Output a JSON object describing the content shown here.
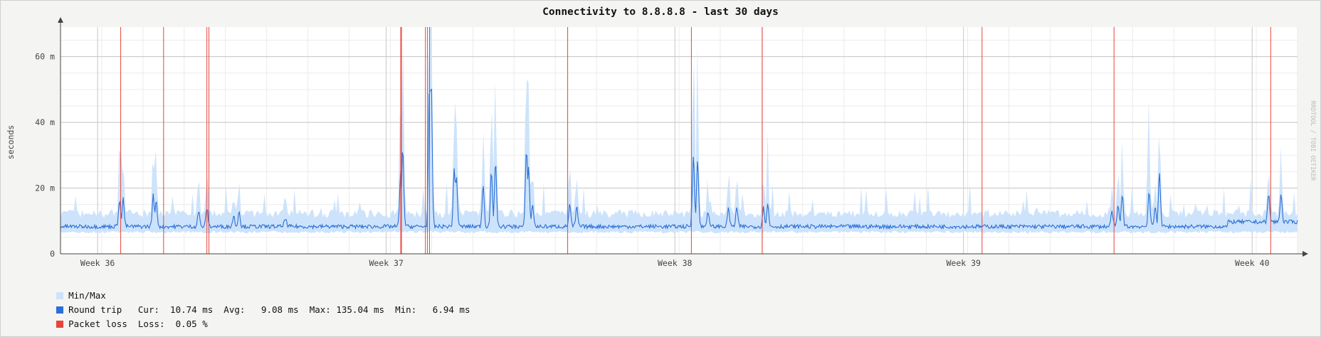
{
  "colors": {
    "minmax": "#cde3fb",
    "roundtrip": "#2a6fd6",
    "packetloss": "#e8443a",
    "grid_major": "#c6c6c6",
    "grid_minor": "#ebebeb",
    "plot_bg": "#ffffff"
  },
  "chart_data": {
    "type": "line",
    "title": "Connectivity to 8.8.8.8 - last 30 days",
    "ylabel": "seconds",
    "watermark": "RRDTOOL / TOBI OETIKER",
    "ylim": [
      0,
      0.069
    ],
    "y_unit": "s",
    "y_ticks": [
      {
        "value": 0,
        "label": "0"
      },
      {
        "value": 0.02,
        "label": "20 m"
      },
      {
        "value": 0.04,
        "label": "40 m"
      },
      {
        "value": 0.06,
        "label": "60 m"
      }
    ],
    "xlim_days": [
      0,
      30
    ],
    "x_ticks": [
      {
        "day": 0.9,
        "label": "Week 36"
      },
      {
        "day": 7.9,
        "label": "Week 37"
      },
      {
        "day": 14.9,
        "label": "Week 38"
      },
      {
        "day": 21.9,
        "label": "Week 39"
      },
      {
        "day": 28.9,
        "label": "Week 40"
      }
    ],
    "series": [
      {
        "name": "Min/Max",
        "kind": "band",
        "baseline_min": 0.007,
        "baseline_max": 0.011
      },
      {
        "name": "Round trip",
        "kind": "line",
        "baseline": 0.0083,
        "stats": {
          "cur": "10.74 ms",
          "avg": "9.08 ms",
          "max": "135.04 ms",
          "min": "6.94 ms"
        },
        "spikes": [
          {
            "day": 1.43,
            "value": 0.0165
          },
          {
            "day": 1.52,
            "value": 0.0168
          },
          {
            "day": 2.25,
            "value": 0.018
          },
          {
            "day": 2.32,
            "value": 0.016
          },
          {
            "day": 3.35,
            "value": 0.013
          },
          {
            "day": 3.55,
            "value": 0.014
          },
          {
            "day": 4.2,
            "value": 0.0115
          },
          {
            "day": 4.33,
            "value": 0.013
          },
          {
            "day": 5.45,
            "value": 0.011
          },
          {
            "day": 8.25,
            "value": 0.025
          },
          {
            "day": 8.3,
            "value": 0.032
          },
          {
            "day": 8.95,
            "value": 0.052
          },
          {
            "day": 8.99,
            "value": 0.053
          },
          {
            "day": 9.55,
            "value": 0.026
          },
          {
            "day": 9.6,
            "value": 0.024
          },
          {
            "day": 10.25,
            "value": 0.021
          },
          {
            "day": 10.45,
            "value": 0.025
          },
          {
            "day": 10.55,
            "value": 0.028
          },
          {
            "day": 11.3,
            "value": 0.032
          },
          {
            "day": 11.35,
            "value": 0.027
          },
          {
            "day": 11.45,
            "value": 0.015
          },
          {
            "day": 12.35,
            "value": 0.015
          },
          {
            "day": 12.52,
            "value": 0.014
          },
          {
            "day": 15.35,
            "value": 0.03
          },
          {
            "day": 15.45,
            "value": 0.029
          },
          {
            "day": 15.7,
            "value": 0.013
          },
          {
            "day": 16.2,
            "value": 0.014
          },
          {
            "day": 16.4,
            "value": 0.014
          },
          {
            "day": 17.05,
            "value": 0.014
          },
          {
            "day": 17.15,
            "value": 0.015
          },
          {
            "day": 25.5,
            "value": 0.013
          },
          {
            "day": 25.65,
            "value": 0.0145
          },
          {
            "day": 25.75,
            "value": 0.018
          },
          {
            "day": 26.4,
            "value": 0.019
          },
          {
            "day": 26.55,
            "value": 0.014
          },
          {
            "day": 26.65,
            "value": 0.025
          },
          {
            "day": 29.3,
            "value": 0.0165
          },
          {
            "day": 29.6,
            "value": 0.0165
          }
        ]
      },
      {
        "name": "Packet loss",
        "kind": "events",
        "loss": "0.05 %",
        "days": [
          1.46,
          2.5,
          3.55,
          3.6,
          8.25,
          8.27,
          8.85,
          8.9,
          8.95,
          12.3,
          15.3,
          17.02,
          22.35,
          25.55,
          29.35
        ]
      }
    ]
  },
  "legend": {
    "minmax_label": "Min/Max",
    "roundtrip_label": "Round trip   Cur:  10.74 ms  Avg:   9.08 ms  Max: 135.04 ms  Min:   6.94 ms",
    "loss_label": "Packet loss  Loss:  0.05 %"
  }
}
